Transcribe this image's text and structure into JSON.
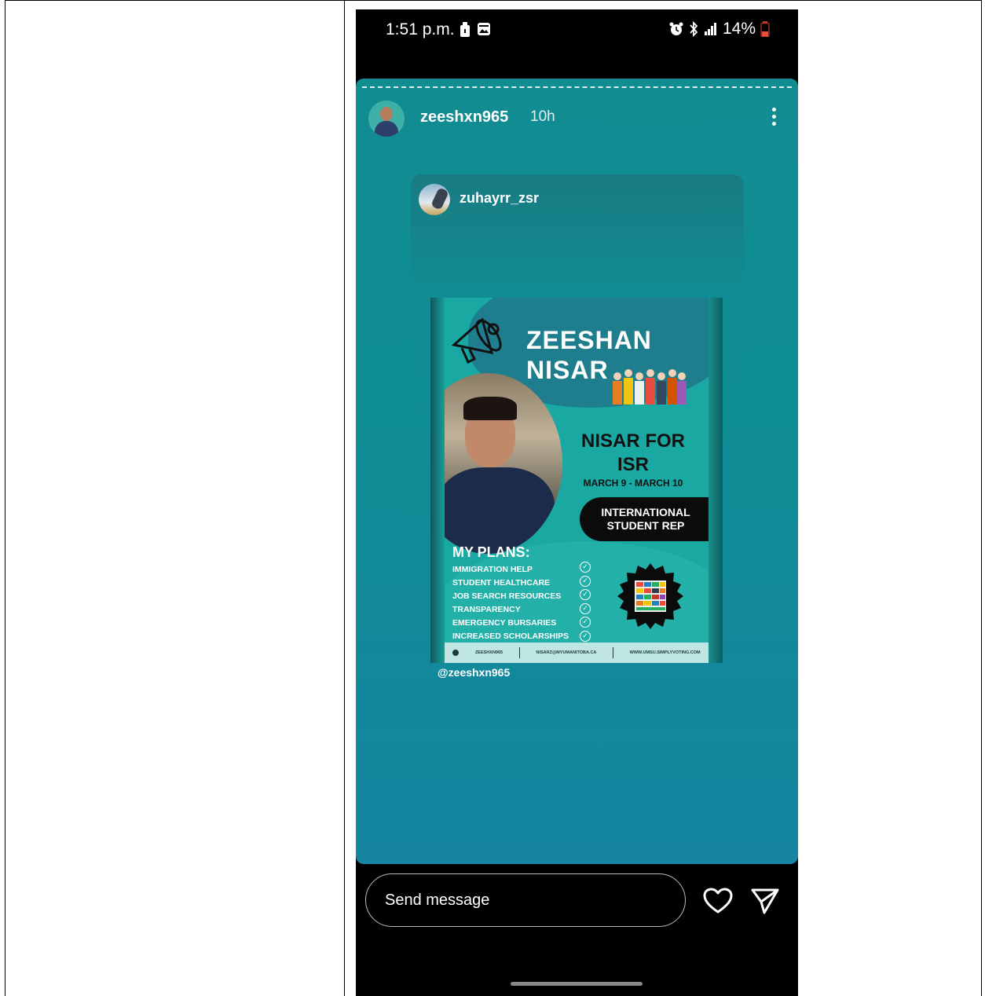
{
  "status_bar": {
    "time": "1:51 p.m.",
    "battery": "14%"
  },
  "story": {
    "username": "zeeshxn965",
    "time_ago": "10h",
    "reshared_from": "zuhayrr_zsr",
    "mention": "@zeeshxn965"
  },
  "poster": {
    "name_line1": "ZEESHAN",
    "name_line2": "NISAR",
    "slogan": "NISAR FOR ISR",
    "dates": "MARCH 9 - MARCH 10",
    "role": "INTERNATIONAL STUDENT REP",
    "plans_heading": "MY PLANS:",
    "plans": [
      "IMMIGRATION HELP",
      "STUDENT HEALTHCARE",
      "JOB SEARCH RESOURCES",
      "TRANSPARENCY",
      "EMERGENCY BURSARIES",
      "INCREASED SCHOLARSHIPS"
    ],
    "footer": {
      "handle": "ZEESHXN965",
      "email": "NISARZ@MYUMANITOBA.CA",
      "website": "WWW.UMSU.SIMPLYVOTING.COM"
    }
  },
  "message_bar": {
    "placeholder": "Send message"
  },
  "icons": {
    "more": "more-vertical-icon",
    "like": "heart-icon",
    "share": "send-icon"
  },
  "colors": {
    "story_bg": "#118c91",
    "poster_bg": "#1aa8a2",
    "text": "#ffffff"
  }
}
